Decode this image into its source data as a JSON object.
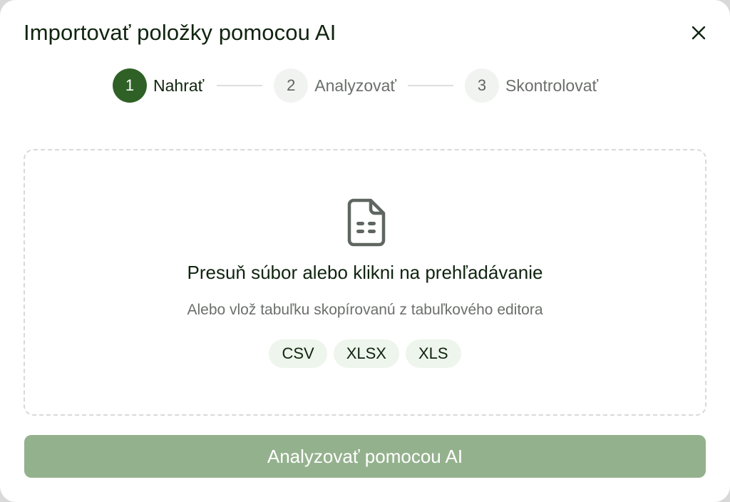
{
  "dialog": {
    "title": "Importovať položky pomocou AI",
    "close_icon": "close-icon"
  },
  "stepper": {
    "steps": [
      {
        "number": "1",
        "label": "Nahrať",
        "active": true
      },
      {
        "number": "2",
        "label": "Analyzovať",
        "active": false
      },
      {
        "number": "3",
        "label": "Skontrolovať",
        "active": false
      }
    ]
  },
  "dropzone": {
    "icon": "spreadsheet-file-icon",
    "title": "Presuň súbor alebo klikni na prehľadávanie",
    "subtitle": "Alebo vlož tabuľku skopírovanú z tabuľkového editora",
    "formats": [
      "CSV",
      "XLSX",
      "XLS"
    ]
  },
  "actions": {
    "analyze_label": "Analyzovať pomocou AI",
    "analyze_disabled": true
  },
  "colors": {
    "accent": "#2f6126",
    "button_disabled": "#94b18d",
    "chip_bg": "#eef5ec",
    "text_primary": "#10240f",
    "text_muted": "#6b6f6b"
  }
}
